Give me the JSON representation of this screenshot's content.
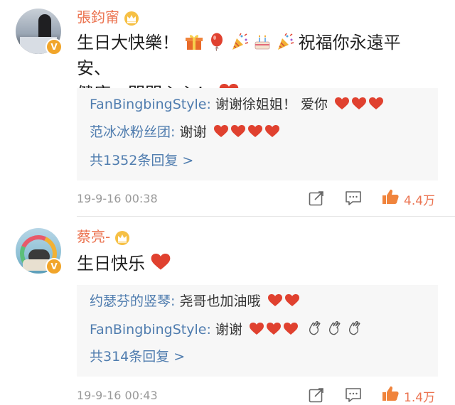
{
  "comments": [
    {
      "username": "張鈞甯",
      "text_part1": "生日大快樂！",
      "text_part2": "祝福你永遠平安、",
      "text_line2": "健康，開開心心！",
      "replies": [
        {
          "user": "FanBingbingStyle:",
          "text": " 谢谢徐姐姐！ 爱你"
        },
        {
          "user": "范冰冰粉丝团:",
          "text": " 谢谢"
        }
      ],
      "more_replies": "共1352条回复 >",
      "time": "19-9-16 00:38",
      "likes": "4.4万"
    },
    {
      "username": "蔡亮-",
      "text": "生日快乐",
      "replies": [
        {
          "user": "约瑟芬的竖琴:",
          "text": " 尧哥也加油哦"
        },
        {
          "user": "FanBingbingStyle:",
          "text": " 谢谢"
        }
      ],
      "more_replies": "共314条回复 >",
      "time": "19-9-16 00:43",
      "likes": "1.4万"
    }
  ],
  "colors": {
    "username": "#eb7350",
    "reply_user": "#507daf",
    "heart": "#e0412f",
    "badge": "#f1a52a"
  },
  "icons": [
    "crown-icon",
    "verified-badge-icon",
    "gift-emoji",
    "balloon-emoji",
    "party-popper-emoji",
    "cake-emoji",
    "heart-emoji",
    "clap-emoji",
    "share-icon",
    "comment-icon",
    "like-icon"
  ]
}
